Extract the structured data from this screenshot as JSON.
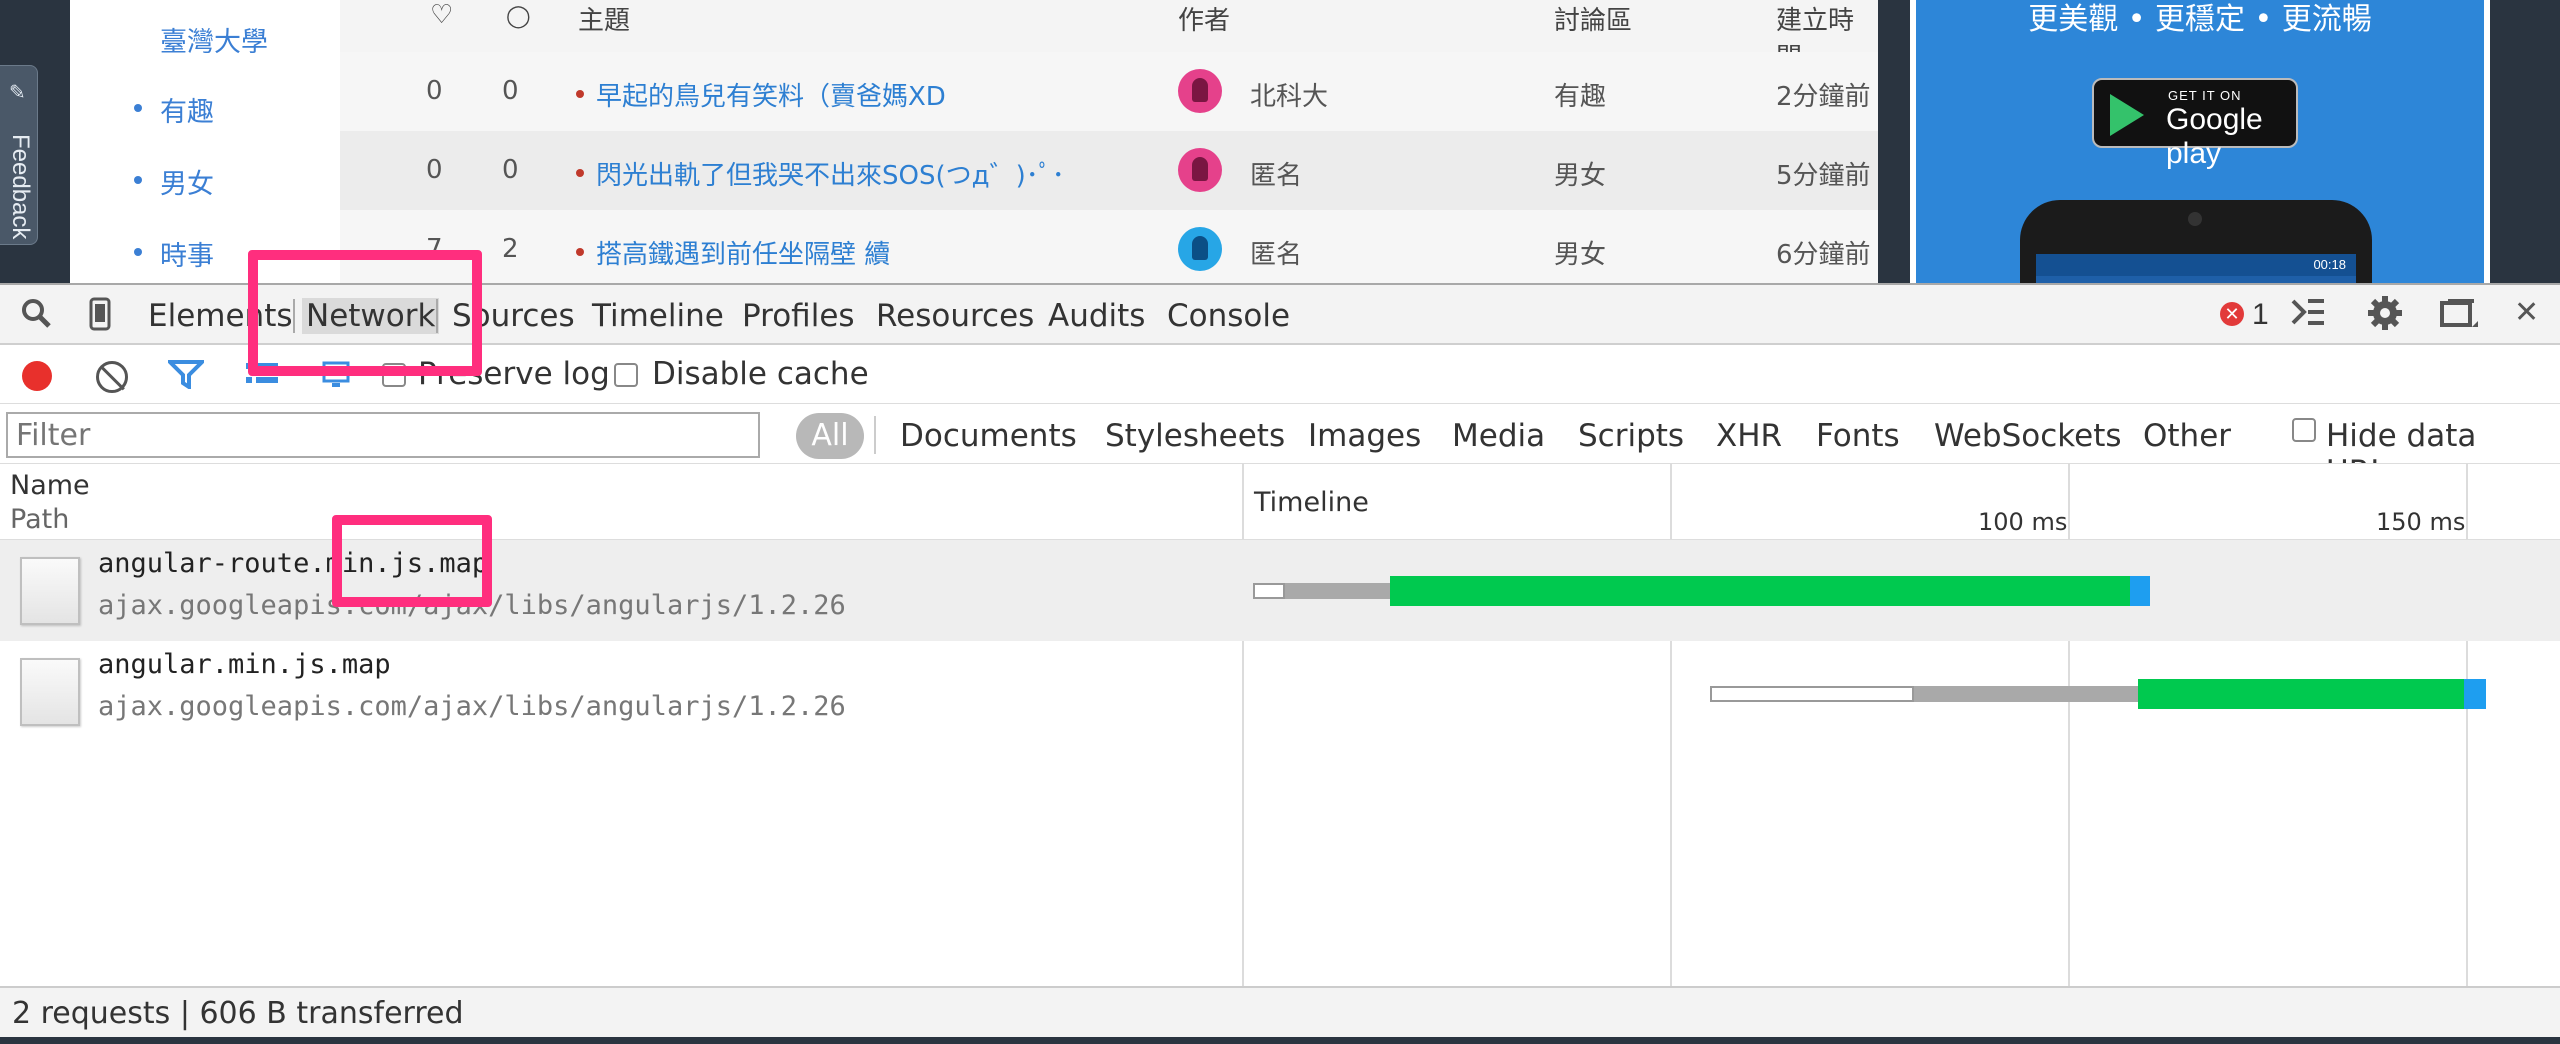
{
  "site": {
    "feedback_label": "Feedback",
    "sidebar": [
      {
        "label": "臺灣大學",
        "bullet": false
      },
      {
        "label": "有趣",
        "bullet": true
      },
      {
        "label": "男女",
        "bullet": true
      },
      {
        "label": "時事",
        "bullet": true
      }
    ],
    "table_headers": {
      "likes": "♡",
      "comments": "💬",
      "title": "主題",
      "author": "作者",
      "board": "討論區",
      "created": "建立時間"
    },
    "posts": [
      {
        "likes": "0",
        "comments": "0",
        "title": "早起的鳥兒有笑料（賣爸媽XD",
        "author": "北科大",
        "avatar": "pink",
        "board": "有趣",
        "created": "2分鐘前"
      },
      {
        "likes": "0",
        "comments": "0",
        "title": "閃光出軌了但我哭不出來SOS(つд゛)･ﾟ･",
        "author": "匿名",
        "avatar": "pink",
        "board": "男女",
        "created": "5分鐘前"
      },
      {
        "likes": "7",
        "comments": "2",
        "title": "搭高鐵遇到前任坐隔壁 續",
        "author": "匿名",
        "avatar": "blue",
        "board": "男女",
        "created": "6分鐘前"
      }
    ],
    "ad": {
      "tagline": "更美觀 • 更穩定 • 更流暢",
      "badge_small": "GET IT ON",
      "badge_big": "Google play",
      "phone_time": "00:18"
    }
  },
  "devtools": {
    "tabs": [
      "Elements",
      "Network",
      "Sources",
      "Timeline",
      "Profiles",
      "Resources",
      "Audits",
      "Console"
    ],
    "active_tab": "Network",
    "error_count": "1",
    "preserve_log_label": "Preserve log",
    "disable_cache_label": "Disable cache",
    "filter_placeholder": "Filter",
    "type_filters": [
      "All",
      "Documents",
      "Stylesheets",
      "Images",
      "Media",
      "Scripts",
      "XHR",
      "Fonts",
      "WebSockets",
      "Other"
    ],
    "hide_data_urls_label": "Hide data URLs",
    "columns": {
      "name": "Name",
      "path": "Path",
      "timeline": "Timeline"
    },
    "timeline_ticks": [
      "100 ms",
      "150 ms"
    ],
    "requests": [
      {
        "name": "angular-route.min.js.map",
        "path": "ajax.googleapis.com/ajax/libs/angularjs/1.2.26",
        "selected": true
      },
      {
        "name": "angular.min.js.map",
        "path": "ajax.googleapis.com/ajax/libs/angularjs/1.2.26",
        "selected": false
      }
    ],
    "status": "2 requests | 606 B transferred"
  },
  "colors": {
    "highlight": "#ff2e7e",
    "timing_green": "#00c94f",
    "timing_blue": "#1e9ef0",
    "record_red": "#e8302c"
  }
}
